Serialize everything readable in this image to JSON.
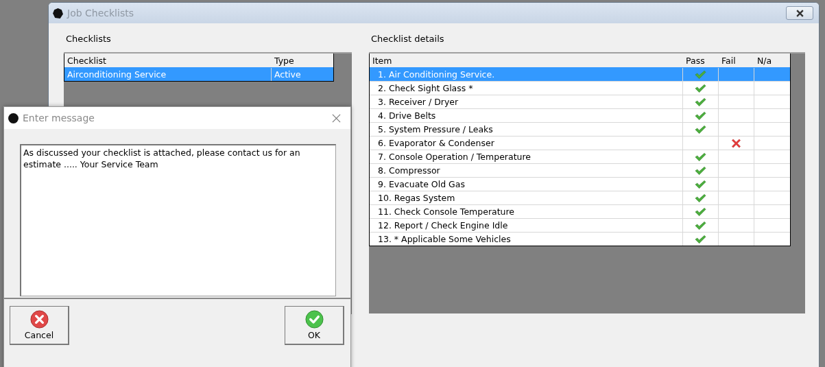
{
  "main_window": {
    "title": "Job Checklists",
    "checklists": {
      "label": "Checklists",
      "columns": [
        "Checklist",
        "Type"
      ],
      "rows": [
        {
          "checklist": "Airconditioning Service",
          "type": "Active",
          "selected": true
        }
      ]
    },
    "details": {
      "label": "Checklist details",
      "columns": [
        "Item",
        "Pass",
        "Fail",
        "N/a"
      ],
      "rows": [
        {
          "item": "1. Air Conditioning Service.",
          "pass": true,
          "fail": false,
          "selected": true
        },
        {
          "item": "2. Check Sight Glass *",
          "pass": true,
          "fail": false,
          "selected": false
        },
        {
          "item": "3. Receiver / Dryer",
          "pass": true,
          "fail": false,
          "selected": false
        },
        {
          "item": "4. Drive Belts",
          "pass": true,
          "fail": false,
          "selected": false
        },
        {
          "item": "5. System Pressure / Leaks",
          "pass": true,
          "fail": false,
          "selected": false
        },
        {
          "item": "6. Evaporator & Condenser",
          "pass": false,
          "fail": true,
          "selected": false
        },
        {
          "item": "7. Console Operation / Temperature",
          "pass": true,
          "fail": false,
          "selected": false
        },
        {
          "item": "8. Compressor",
          "pass": true,
          "fail": false,
          "selected": false
        },
        {
          "item": "9. Evacuate Old Gas",
          "pass": true,
          "fail": false,
          "selected": false
        },
        {
          "item": "10. Regas System",
          "pass": true,
          "fail": false,
          "selected": false
        },
        {
          "item": "11. Check Console Temperature",
          "pass": true,
          "fail": false,
          "selected": false
        },
        {
          "item": "12. Report / Check Engine Idle",
          "pass": true,
          "fail": false,
          "selected": false
        },
        {
          "item": "13. * Applicable Some Vehicles",
          "pass": true,
          "fail": false,
          "selected": false
        }
      ]
    }
  },
  "dialog": {
    "title": "Enter message",
    "message": "As discussed your checklist is attached, please contact us for an estimate ..... Your Service Team",
    "buttons": [
      {
        "label": "Cancel",
        "kind": "cancel"
      },
      {
        "label": "OK",
        "kind": "ok"
      }
    ]
  }
}
